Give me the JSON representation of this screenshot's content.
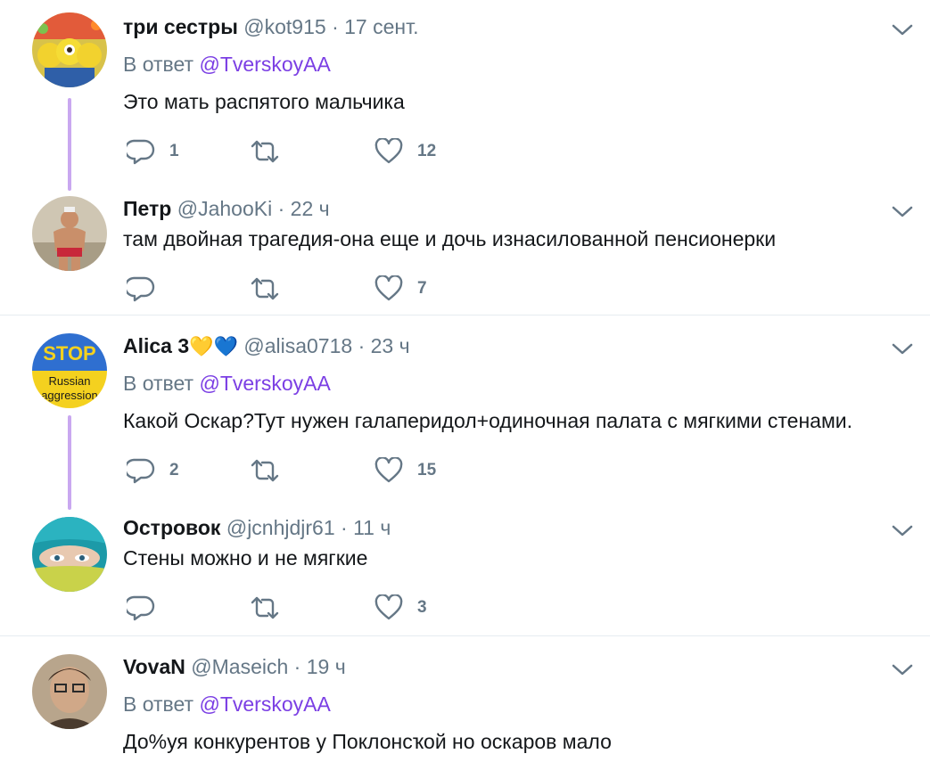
{
  "tweets": [
    {
      "name": "три сестры",
      "handle": "@kot915",
      "dot": "·",
      "time": "17 сент.",
      "reply_prefix": "В ответ",
      "reply_mention": "@TverskoyAA",
      "text": "Это мать распятого мальчика",
      "replies": "1",
      "retweets": "",
      "likes": "12"
    },
    {
      "name": "Петр",
      "handle": "@JahooKi",
      "dot": "·",
      "time": "22 ч",
      "text": "там двойная трагедия-она еще и дочь изнасилованной пенсионерки",
      "replies": "",
      "retweets": "",
      "likes": "7"
    },
    {
      "name": "Alicа 3",
      "name_emoji": "💛💙",
      "handle": "@alisa0718",
      "dot": "·",
      "time": "23 ч",
      "reply_prefix": "В ответ",
      "reply_mention": "@TverskoyAA",
      "text": "Какой Оскар?Тут нужен галаперидол+одиночная палата с мягкими стенами.",
      "replies": "2",
      "retweets": "",
      "likes": "15"
    },
    {
      "name": "Островок",
      "handle": "@jcnhjdjr61",
      "dot": "·",
      "time": "11 ч",
      "text": "Стены можно и не мягкие",
      "replies": "",
      "retweets": "",
      "likes": "3"
    },
    {
      "name": "VovaN",
      "handle": "@Maseich",
      "dot": "·",
      "time": "19 ч",
      "reply_prefix": "В ответ",
      "reply_mention": "@TverskoyAA",
      "text": "До%уя конкурентов у Поклонсҡой но оскаров мало"
    }
  ],
  "avatars": {
    "stop_badge_top": "STOP",
    "stop_badge_mid": "Russian",
    "stop_badge_bot": "aggression"
  },
  "icons": {
    "reply": "reply-icon",
    "retweet": "retweet-icon",
    "like": "heart-icon",
    "menu": "chevron-down-icon"
  },
  "colors": {
    "text": "#14171a",
    "muted": "#657786",
    "mention": "#7b3fe4",
    "thread_line": "#c9a8f0",
    "divider": "#e6ecf0"
  }
}
